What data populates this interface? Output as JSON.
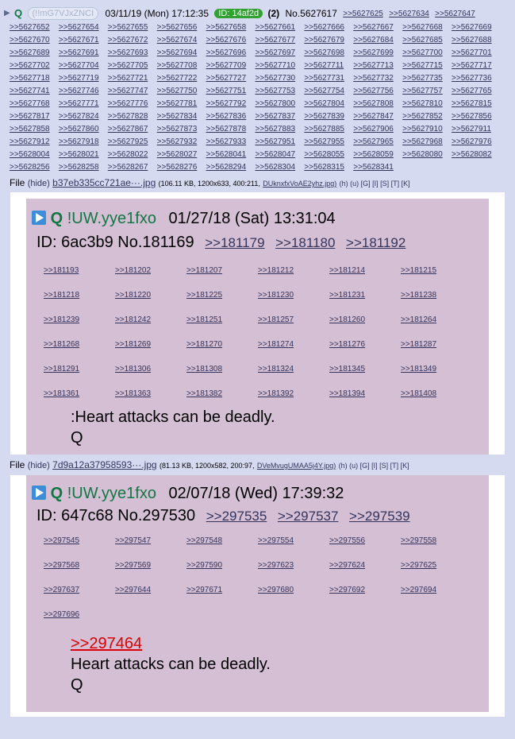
{
  "header": {
    "arrow": "▶",
    "name": "Q",
    "tripcode": "(!!mG7VJxZNCI",
    "date": "03/11/19 (Mon) 17:12:35",
    "id_badge": "ID: 14af2d",
    "count": "(2)",
    "post_no": "No.5627617",
    "replies_inline": [
      ">>5627625",
      ">>5627634",
      ">>5627647"
    ]
  },
  "replies": [
    ">>5627652",
    ">>5627654",
    ">>5627655",
    ">>5627656",
    ">>5627658",
    ">>5627661",
    ">>5627666",
    ">>5627667",
    ">>5627668",
    ">>5627669",
    ">>5627670",
    ">>5627671",
    ">>5627672",
    ">>5627674",
    ">>5627676",
    ">>5627677",
    ">>5627679",
    ">>5627684",
    ">>5627685",
    ">>5627688",
    ">>5627689",
    ">>5627691",
    ">>5627693",
    ">>5627694",
    ">>5627696",
    ">>5627697",
    ">>5627698",
    ">>5627699",
    ">>5627700",
    ">>5627701",
    ">>5627702",
    ">>5627704",
    ">>5627705",
    ">>5627708",
    ">>5627709",
    ">>5627710",
    ">>5627711",
    ">>5627713",
    ">>5627715",
    ">>5627717",
    ">>5627718",
    ">>5627719",
    ">>5627721",
    ">>5627722",
    ">>5627727",
    ">>5627730",
    ">>5627731",
    ">>5627732",
    ">>5627735",
    ">>5627736",
    ">>5627741",
    ">>5627746",
    ">>5627747",
    ">>5627750",
    ">>5627751",
    ">>5627753",
    ">>5627754",
    ">>5627756",
    ">>5627757",
    ">>5627765",
    ">>5627768",
    ">>5627771",
    ">>5627776",
    ">>5627781",
    ">>5627792",
    ">>5627800",
    ">>5627804",
    ">>5627808",
    ">>5627810",
    ">>5627815",
    ">>5627817",
    ">>5627824",
    ">>5627828",
    ">>5627834",
    ">>5627836",
    ">>5627837",
    ">>5627839",
    ">>5627847",
    ">>5627852",
    ">>5627856",
    ">>5627858",
    ">>5627860",
    ">>5627867",
    ">>5627873",
    ">>5627878",
    ">>5627883",
    ">>5627885",
    ">>5627906",
    ">>5627910",
    ">>5627911",
    ">>5627912",
    ">>5627918",
    ">>5627925",
    ">>5627932",
    ">>5627933",
    ">>5627951",
    ">>5627955",
    ">>5627965",
    ">>5627968",
    ">>5627976",
    ">>5628004",
    ">>5628021",
    ">>5628022",
    ">>5628027",
    ">>5628041",
    ">>5628047",
    ">>5628055",
    ">>5628059",
    ">>5628080",
    ">>5628082",
    ">>5628256",
    ">>5628258",
    ">>5628267",
    ">>5628276",
    ">>5628294",
    ">>5628304",
    ">>5628315",
    ">>5628341"
  ],
  "file1": {
    "label": "File",
    "hide": "(hide)",
    "name": "b37eb335cc721ae···.jpg",
    "meta": "(106.11 KB, 1200x633, 400:211,",
    "orig": "DUknxfxVoAE2yhz.jpg)",
    "links": "(h) (u) [G] [I] [S] [T] [K]"
  },
  "post1": {
    "q": "Q",
    "trip": "!UW.yye1fxo",
    "date": "01/27/18 (Sat) 13:31:04",
    "id": "ID: 6ac3b9 No.181169",
    "head_replies": [
      ">>181179",
      ">>181180",
      ">>181192"
    ],
    "replies": [
      ">>181193",
      ">>181202",
      ">>181207",
      ">>181212",
      ">>181214",
      ">>181215",
      ">>181218",
      ">>181220",
      ">>181225",
      ">>181230",
      ">>181231",
      ">>181238",
      ">>181239",
      ">>181242",
      ">>181251",
      ">>181257",
      ">>181260",
      ">>181264",
      ">>181268",
      ">>181269",
      ">>181270",
      ">>181274",
      ">>181276",
      ">>181287",
      ">>181291",
      ">>181306",
      ">>181308",
      ">>181324",
      ">>181345",
      ">>181349",
      ">>181361",
      ">>181363",
      ">>181382",
      ">>181392",
      ">>181394",
      ">>181408"
    ],
    "line1": ":Heart attacks can be deadly.",
    "line2": "Q"
  },
  "file2": {
    "label": "File",
    "hide": "(hide)",
    "name": "7d9a12a37958593···.jpg",
    "meta": "(81.13 KB, 1200x582, 200:97,",
    "orig": "DVeMvugUMAA5j4Y.jpg)",
    "links": "(h) (u) [G] [I] [S] [T] [K]"
  },
  "post2": {
    "q": "Q",
    "trip": "!UW.yye1fxo",
    "date": "02/07/18 (Wed) 17:39:32",
    "id": "ID: 647c68 No.297530",
    "head_replies": [
      ">>297535",
      ">>297537",
      ">>297539"
    ],
    "replies": [
      ">>297545",
      ">>297547",
      ">>297548",
      ">>297554",
      ">>297556",
      ">>297558",
      ">>297568",
      ">>297569",
      ">>297590",
      ">>297623",
      ">>297624",
      ">>297625",
      ">>297637",
      ">>297644",
      ">>297671",
      ">>297680",
      ">>297692",
      ">>297694",
      ">>297696"
    ],
    "quote": ">>297464",
    "line1": "Heart attacks can be deadly.",
    "line2": "Q"
  },
  "colors": {
    "background": "#d6daf0",
    "post_bg": "#d4bfd4",
    "name_green": "#117743",
    "link": "#34345c",
    "id_badge": "#2fa232",
    "quote_red": "#dd0000"
  }
}
